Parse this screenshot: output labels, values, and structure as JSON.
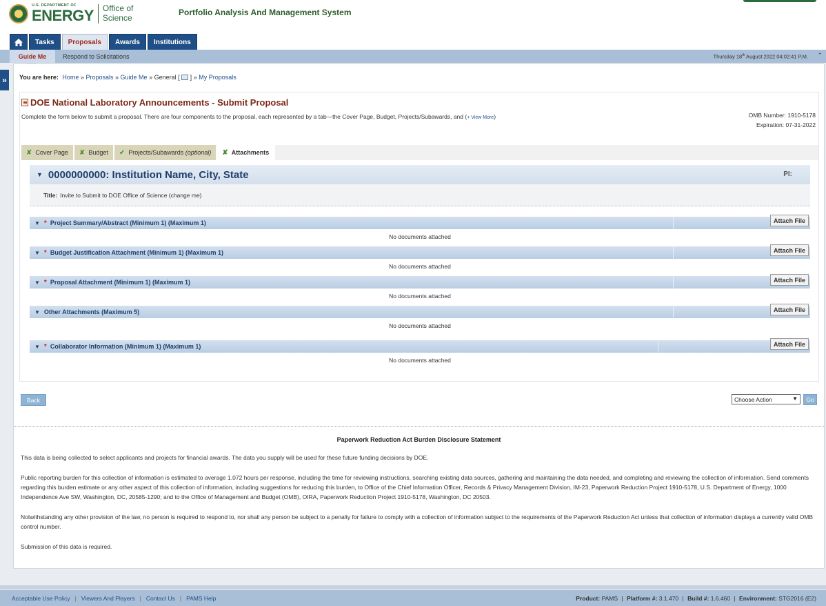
{
  "header": {
    "logo_usdoe": "U.S. DEPARTMENT OF",
    "logo_energy": "ENERGY",
    "logo_office": "Office of",
    "logo_science": "Science",
    "app_title": "Portfolio Analysis And Management System"
  },
  "main_nav": {
    "tasks": "Tasks",
    "proposals": "Proposals",
    "awards": "Awards",
    "institutions": "Institutions"
  },
  "sub_nav": {
    "guide_me": "Guide Me",
    "respond": "Respond to Solicitations",
    "datetime_pre": "Thursday 18",
    "datetime_sup": "th",
    "datetime_post": " August 2022 04:02:41 P.M."
  },
  "breadcrumb": {
    "lead": "You are here:",
    "home": "Home",
    "proposals": "Proposals",
    "guide_me": "Guide Me",
    "general": "General [",
    "general_close": "]",
    "my_proposals": "My Proposals",
    "sep": "»"
  },
  "page": {
    "title": "DOE National Laboratory Announcements - Submit Proposal",
    "intro": "Complete the form below to submit a proposal. There are four components to the proposal, each represented by a tab—the Cover Page, Budget, Projects/Subawards, and (",
    "view_more": "+ View More",
    "intro_close": ")",
    "omb_number": "OMB Number: 1910-5178",
    "expiration": "Expiration: 07-31-2022"
  },
  "tabs": [
    {
      "label": "Cover Page",
      "icon": "x-check"
    },
    {
      "label": "Budget",
      "icon": "x-check"
    },
    {
      "label": "Projects/Subawards",
      "suffix": "(optional)",
      "icon": "check"
    },
    {
      "label": "Attachments",
      "icon": "x-check"
    }
  ],
  "institution": {
    "name": "0000000000: Institution Name, City, State",
    "pi_label": "PI:",
    "title_label": "Title:",
    "title_value": "Invite to Submit to DOE Office of Science (change me)"
  },
  "attachments": [
    {
      "label": "Project Summary/Abstract (Minimum 1) (Maximum 1)",
      "required": true,
      "button": "Attach File",
      "empty": "No documents attached"
    },
    {
      "label": "Budget Justification Attachment (Minimum 1) (Maximum 1)",
      "required": true,
      "button": "Attach File",
      "empty": "No documents attached"
    },
    {
      "label": "Proposal Attachment (Minimum 1) (Maximum 1)",
      "required": true,
      "button": "Attach File",
      "empty": "No documents attached"
    },
    {
      "label": "Other Attachments (Maximum 5)",
      "required": false,
      "button": "Attach File",
      "empty": "No documents attached"
    },
    {
      "label": "Collaborator Information (Minimum 1) (Maximum 1)",
      "required": true,
      "button": "Attach File",
      "empty": "No documents attached"
    }
  ],
  "required_marker": "*",
  "actions": {
    "back": "Back",
    "choose_action": "Choose Action",
    "go": "Go"
  },
  "disclosure": {
    "heading": "Paperwork Reduction Act Burden Disclosure Statement",
    "p1": "This data is being collected to select applicants and projects for financial awards. The data you supply will be used for these future funding decisions by DOE.",
    "p2": "Public reporting burden for this collection of information is estimated to average 1.072 hours per response, including the time for reviewing instructions, searching existing data sources, gathering and maintaining the data needed, and completing and reviewing the collection of information. Send comments regarding this burden estimate or any other aspect of this collection of information, including suggestions for reducing this burden, to Office of the Chief Information Officer, Records & Privacy Management Division, IM-23, Paperwork Reduction Project 1910-5178, U.S. Department of Energy, 1000 Independence Ave SW, Washington, DC, 20585-1290; and to the Office of Management and Budget (OMB), OIRA, Paperwork Reduction Project 1910-5178, Washington, DC 20503.",
    "p3": "Notwithstanding any other provision of the law, no person is required to respond to, nor shall any person be subject to a penalty for failure to comply with a collection of information subject to the requirements of the Paperwork Reduction Act unless that collection of information displays a currently valid OMB control number.",
    "p4": "Submission of this data is required."
  },
  "footer": {
    "links": [
      "Acceptable Use Policy",
      "Viewers And Players",
      "Contact Us",
      "PAMS Help"
    ],
    "product_label": "Product:",
    "product_value": "PAMS",
    "platform_label": "Platform #:",
    "platform_value": "3.1.470",
    "build_label": "Build #:",
    "build_value": "1.6.460",
    "env_label": "Environment:",
    "env_value": "STG2016 (E2)"
  },
  "icons": {
    "home": "home-icon",
    "expand": "double-chevron-right-icon",
    "collapse": "double-chevron-up-icon",
    "calendar": "calendar-icon",
    "document": "document-icon",
    "caret": "caret-down-icon"
  },
  "colors": {
    "nav_blue": "#1f4f86",
    "doe_green": "#2d6a3e",
    "title_red": "#7a2a17",
    "required_red": "#c0242b"
  }
}
